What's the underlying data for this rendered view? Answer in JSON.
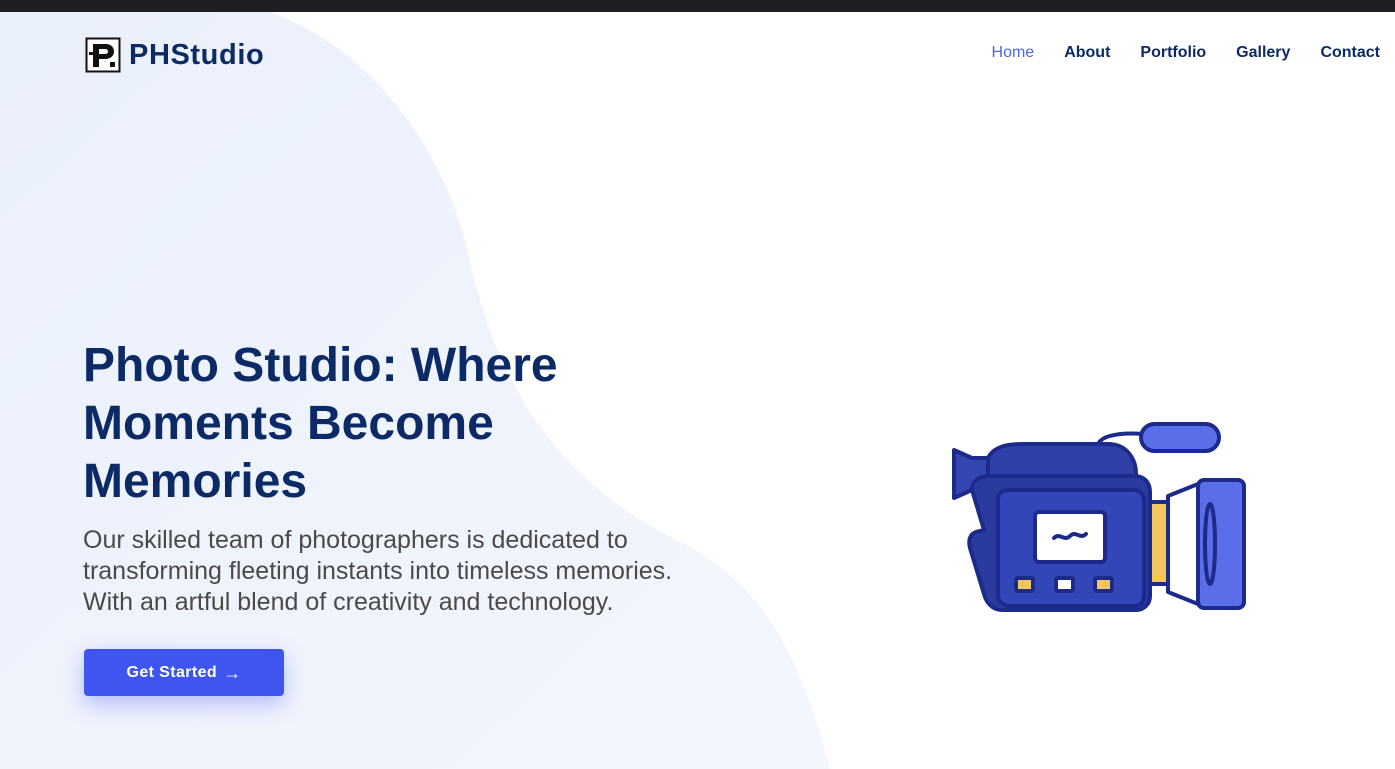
{
  "brand": {
    "name": "PHStudio",
    "color": "#0b2a66"
  },
  "nav": {
    "items": [
      {
        "label": "Home",
        "active": true
      },
      {
        "label": "About"
      },
      {
        "label": "Portfolio"
      },
      {
        "label": "Gallery"
      },
      {
        "label": "Contact"
      }
    ]
  },
  "hero": {
    "title": "Photo Studio: Where Moments Become Memories",
    "description": "Our skilled team of photographers is dedicated to transforming fleeting instants into timeless memories. With an artful blend of creativity and technology.",
    "cta_label": "Get Started",
    "cta_arrow": "→"
  },
  "illustration": {
    "icon": "video-camera-icon"
  },
  "colors": {
    "accent": "#3e55ef",
    "nav_active": "#4a6bd6",
    "heading": "#0b2a66",
    "body_text": "#4a4a4a",
    "background_blob": "#eef2fb"
  }
}
